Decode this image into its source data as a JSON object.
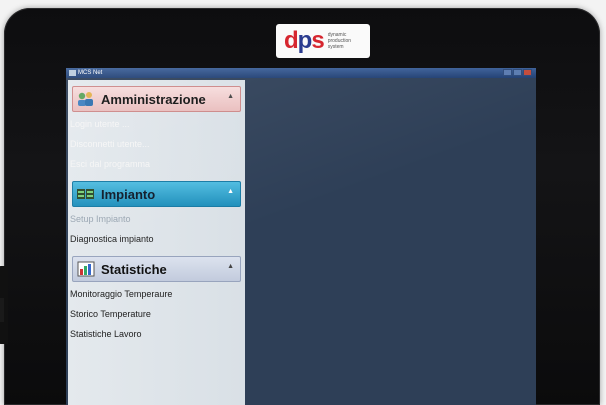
{
  "device": {
    "logo_text": "dynamic production system",
    "brand_colors": {
      "red": "#d6262f",
      "blue": "#2a3b8f"
    }
  },
  "window": {
    "title": "MCS Net",
    "icon": "app-icon"
  },
  "sidebar": {
    "groups": [
      {
        "label": "Amministrazione",
        "icon": "users-icon",
        "items": [
          {
            "label": "Login utente ...",
            "enabled": false
          },
          {
            "label": "Disconnetti utente...",
            "enabled": true
          },
          {
            "label": "Esci dal programma",
            "enabled": true
          }
        ]
      },
      {
        "label": "Impianto",
        "icon": "plant-icon",
        "items": [
          {
            "label": "Setup Impianto",
            "enabled": false
          },
          {
            "label": "Diagnostica impianto",
            "enabled": true
          }
        ]
      },
      {
        "label": "Statistiche",
        "icon": "chart-icon",
        "items": [
          {
            "label": "Monitoraggio Temperaure",
            "enabled": true
          },
          {
            "label": "Storico Temperature",
            "enabled": true
          },
          {
            "label": "Statistiche Lavoro",
            "enabled": true
          }
        ]
      }
    ]
  }
}
